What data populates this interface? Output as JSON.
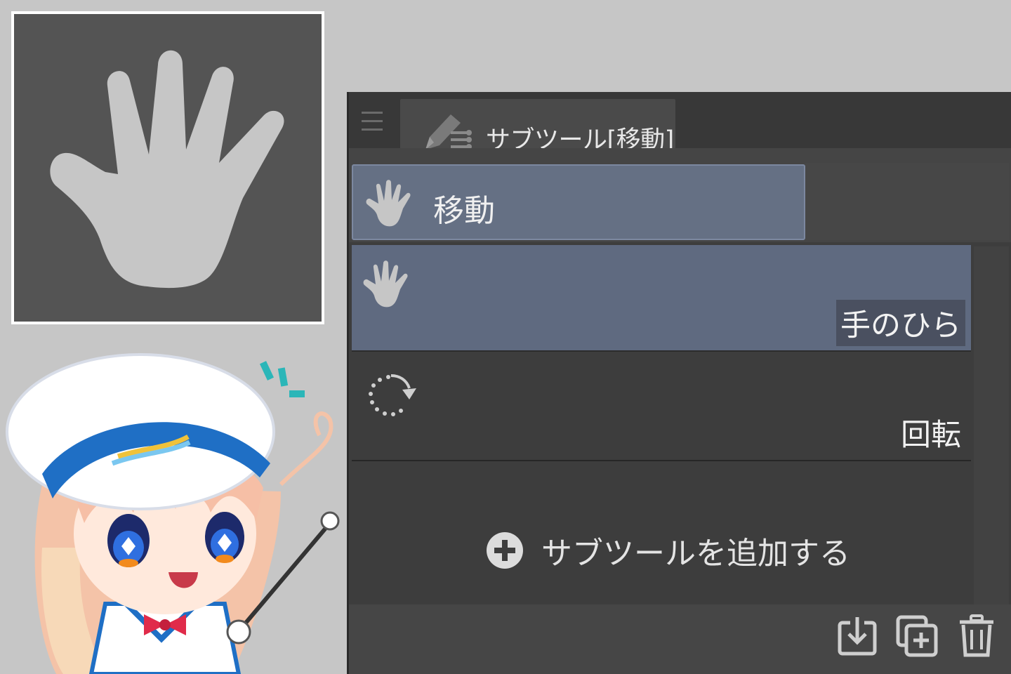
{
  "panel": {
    "tab_title": "サブツール[移動]",
    "group": {
      "label": "移動",
      "icon": "hand-icon"
    },
    "subtools": [
      {
        "label": "手のひら",
        "icon": "hand-icon",
        "selected": true
      },
      {
        "label": "回転",
        "icon": "rotate-icon",
        "selected": false
      }
    ],
    "add_label": "サブツールを追加する",
    "footer_icons": [
      "import-icon",
      "duplicate-icon",
      "trash-icon"
    ]
  },
  "colors": {
    "panel_bg": "#3d3d3d",
    "selected_bg": "#5f6a80",
    "preview_bg": "#545454",
    "page_bg": "#c6c6c6"
  }
}
